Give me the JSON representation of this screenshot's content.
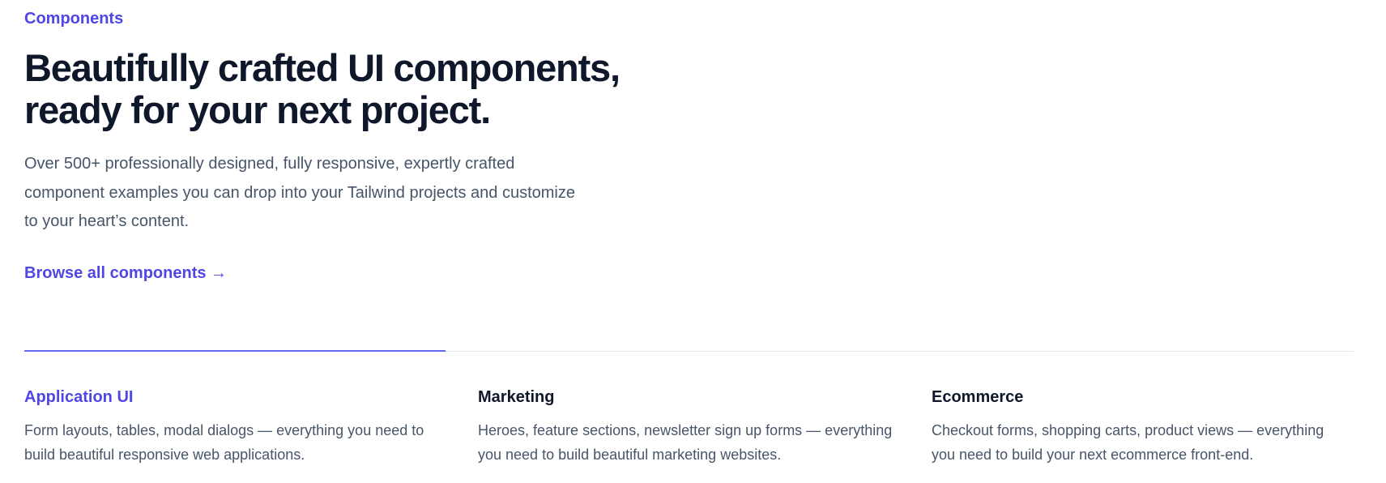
{
  "hero": {
    "eyebrow": "Components",
    "headline": "Beautifully crafted UI components, ready for your next project.",
    "description": "Over 500+ professionally designed, fully responsive, expertly crafted component examples you can drop into your Tailwind projects and customize to your heart’s content.",
    "cta_label": "Browse all components →"
  },
  "tabs": [
    {
      "title": "Application UI",
      "description": "Form layouts, tables, modal dialogs — everything you need to build beautiful responsive web applications.",
      "active": true
    },
    {
      "title": "Marketing",
      "description": "Heroes, feature sections, newsletter sign up forms — everything you need to build beautiful marketing websites.",
      "active": false
    },
    {
      "title": "Ecommerce",
      "description": "Checkout forms, shopping carts, product views — everything you need to build your next ecommerce front-end.",
      "active": false
    }
  ],
  "colors": {
    "accent": "#4f46e5",
    "accent_bar": "#6366f1",
    "heading": "#0f172a",
    "body_text": "#475569",
    "rule": "#e2e8f0"
  }
}
